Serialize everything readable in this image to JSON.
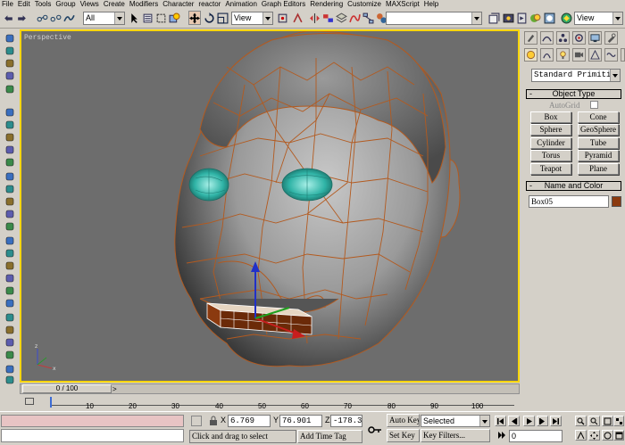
{
  "menubar": {
    "items": [
      "File",
      "Edit",
      "Tools",
      "Group",
      "Views",
      "Create",
      "Modifiers",
      "Character",
      "reactor",
      "Animation",
      "Graph Editors",
      "Rendering",
      "Customize",
      "MAXScript",
      "Help"
    ]
  },
  "toolbar": {
    "selection_filter": "All",
    "reference_coord": "View",
    "named_selection": "",
    "render_view": "View"
  },
  "viewport": {
    "label": "Perspective"
  },
  "command_panel": {
    "category_dropdown": "Standard Primitiv",
    "object_type": {
      "title": "Object Type",
      "autogrid_label": "AutoGrid",
      "buttons": [
        "Box",
        "Cone",
        "Sphere",
        "GeoSphere",
        "Cylinder",
        "Tube",
        "Torus",
        "Pyramid",
        "Teapot",
        "Plane"
      ]
    },
    "name_and_color": {
      "title": "Name and Color",
      "object_name": "Box05",
      "object_color": "#8b3a0f"
    },
    "collapse_marker": "-"
  },
  "timeline": {
    "frame_indicator": "0 / 100",
    "ticks": [
      "0",
      "10",
      "20",
      "30",
      "40",
      "50",
      "60",
      "70",
      "80",
      "90",
      "100"
    ]
  },
  "status": {
    "prompt": "Click and drag to select",
    "x_label": "X",
    "x_value": "6.769",
    "y_label": "Y",
    "y_value": "76.901",
    "z_label": "Z",
    "z_value": "-178.36",
    "add_time_tag": "Add Time Tag",
    "auto_key": "Auto Key",
    "set_key": "Set Key",
    "key_mode": "Selected",
    "key_filters": "Key Filters...",
    "current_frame": "0"
  },
  "colors": {
    "viewport_border": "#f6d50b",
    "wireframe": "#b35a1f",
    "eye": "#2fb3a6",
    "ui_face": "#d4d0c8"
  }
}
